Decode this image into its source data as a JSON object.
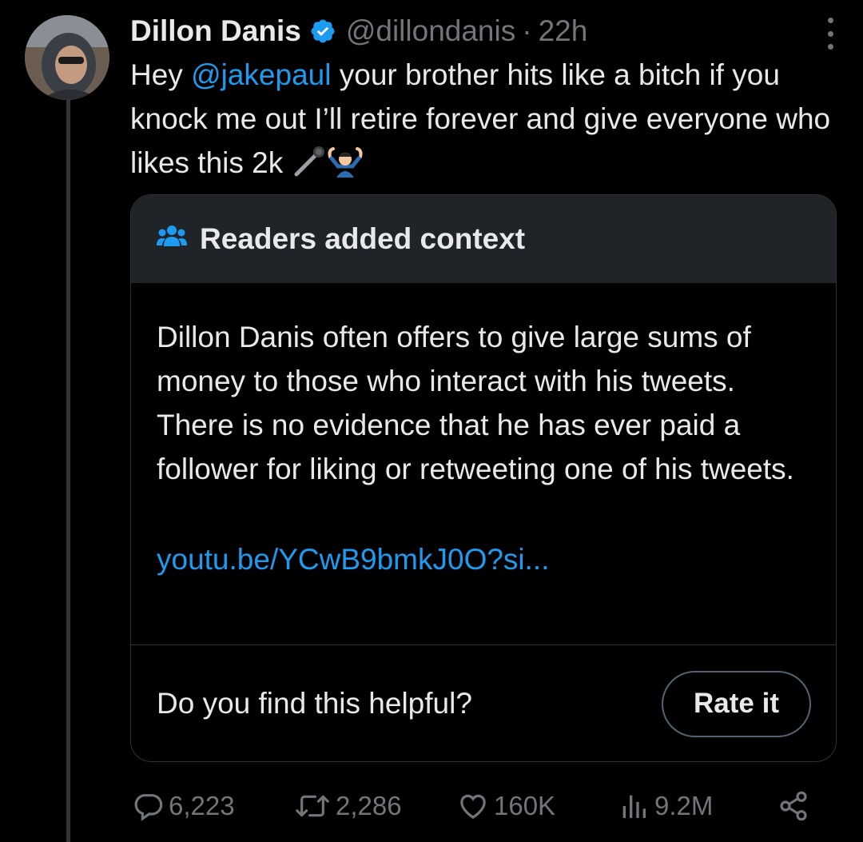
{
  "tweet": {
    "author_name": "Dillon Danis",
    "handle": "@dillondanis",
    "separator": "·",
    "time": "22h",
    "text_before": "Hey ",
    "mention": "@jakepaul",
    "text_after": " your brother hits like a bitch if you knock me out I’ll retire forever and give everyone who likes this 2k"
  },
  "note": {
    "title": "Readers added context",
    "body": "Dillon Danis often offers to give large sums of money to those who interact with his tweets. There is no evidence that he has ever paid a follower for liking or retweeting one of his tweets.",
    "link": "youtu.be/YCwB9bmkJ0O?si...",
    "question": "Do you find this helpful?",
    "rate_label": "Rate it"
  },
  "stats": {
    "replies": "6,223",
    "reposts": "2,286",
    "likes": "160K",
    "views": "9.2M"
  },
  "icons": {
    "verified": "verified-badge-icon",
    "more": "more-vertical-icon",
    "readers": "people-icon",
    "reply": "reply-icon",
    "repost": "repost-icon",
    "like": "heart-icon",
    "views": "views-icon",
    "share": "share-icon"
  },
  "colors": {
    "background": "#000000",
    "accent": "#1d9bf0",
    "text": "#e7e9ea",
    "muted": "#71767b",
    "note_header": "#202327"
  }
}
